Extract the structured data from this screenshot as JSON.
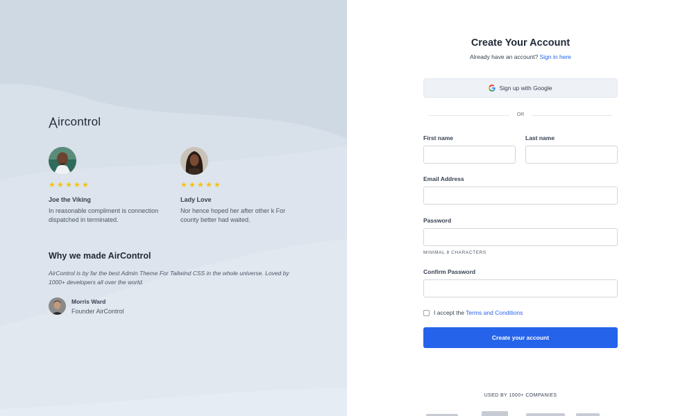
{
  "left": {
    "logo_text": "ircontrol",
    "testimonials": [
      {
        "name": "Joe the Viking",
        "text": "In reasonable compliment is connection dispatched in terminated.",
        "rating": 5
      },
      {
        "name": "Lady Love",
        "text": "Nor hence hoped her after other k For county better had waited.",
        "rating": 5
      }
    ],
    "why_title": "Why we made AirControl",
    "why_text": "AirControl is by far the best Admin Theme For Tailwind CSS in the whole universe. Loved by 1000+ developers all over the world.",
    "author": {
      "name": "Morris Ward",
      "role": "Founder AirControl"
    }
  },
  "form": {
    "title": "Create Your Account",
    "subtitle_prefix": "Already have an account?",
    "signin_link": "Sign in here",
    "google_label": "Sign up with Google",
    "or_label": "OR",
    "first_name_label": "First name",
    "first_name_value": "",
    "last_name_label": "Last name",
    "last_name_value": "",
    "email_label": "Email Address",
    "email_value": "",
    "password_label": "Password",
    "password_value": "",
    "password_hint": "MINIMAL 8 CHARACTERS",
    "confirm_label": "Confirm Password",
    "confirm_value": "",
    "terms_prefix": "I accept the",
    "terms_link": "Terms and Conditions",
    "terms_checked": false,
    "submit_label": "Create your account",
    "used_by": "USED BY 1000+ COMPANIES"
  },
  "colors": {
    "primary": "#2563eb",
    "left_bg": "#d8e0ea",
    "star": "#f5c20b"
  }
}
